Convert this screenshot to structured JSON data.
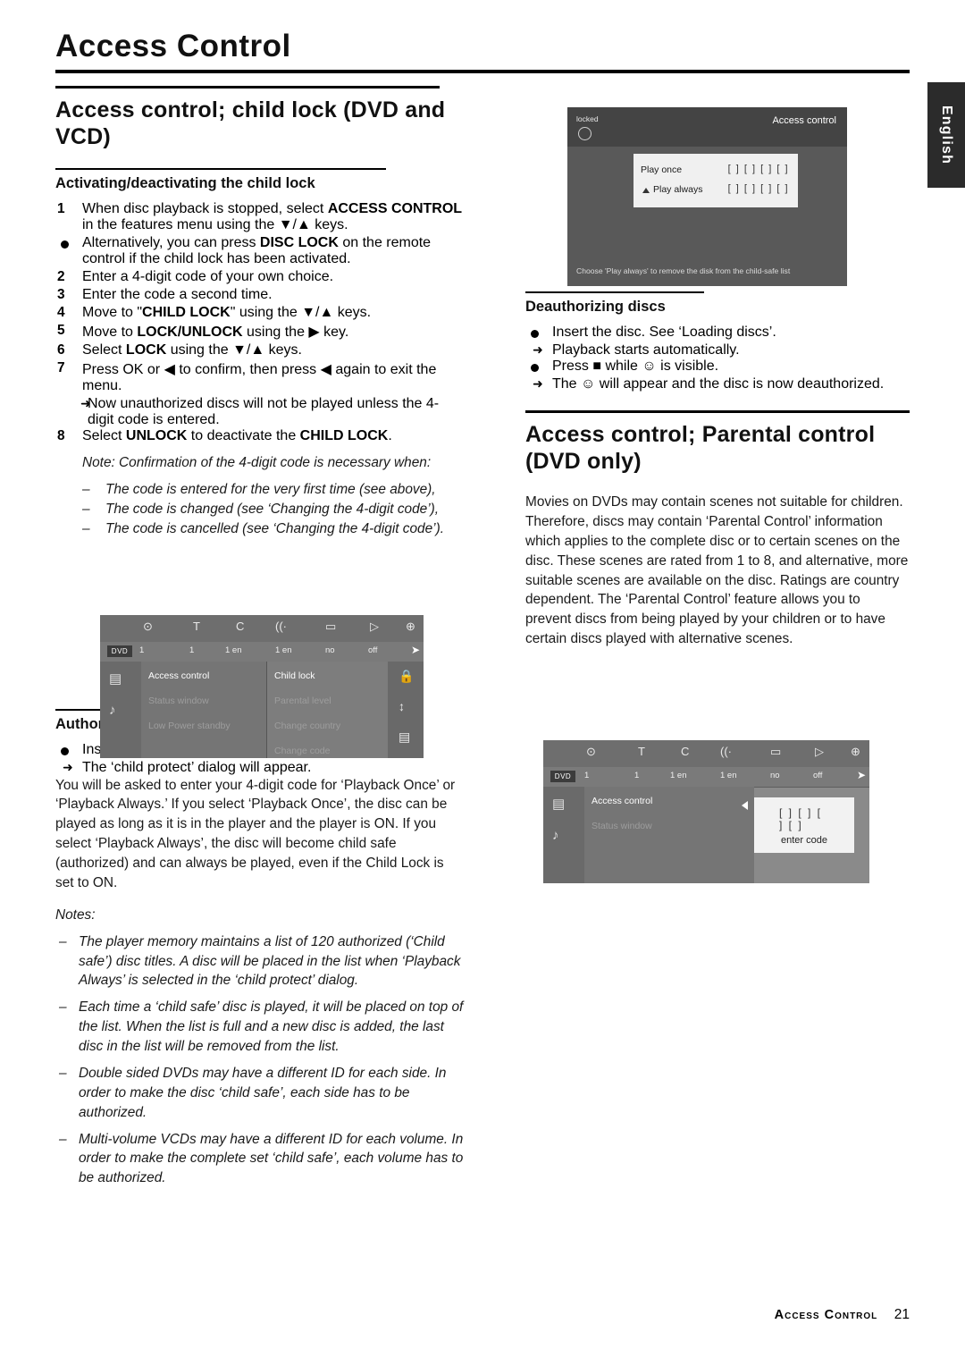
{
  "header": {
    "title": "Access Control",
    "language_tab": "English"
  },
  "left_column": {
    "section_title": "Access control; child lock (DVD and VCD)",
    "subsection_1": "Activating/deactivating the child lock",
    "steps": [
      {
        "num": "1",
        "parts": [
          "When disc playback is stopped, select ",
          "ACCESS CONTROL",
          " in the features menu using the ▼/▲ keys."
        ]
      },
      {
        "num": "2",
        "text": "Enter a 4-digit code of your own choice."
      },
      {
        "num": "3",
        "text": "Enter the code a second time."
      },
      {
        "num": "4",
        "parts": [
          "Move to \"",
          "CHILD LOCK",
          "\" using the ▼/▲ keys."
        ]
      },
      {
        "num": "5",
        "parts": [
          "Move to ",
          "LOCK/UNLOCK",
          " using the ▶ key."
        ]
      },
      {
        "num": "6",
        "parts": [
          "Select ",
          "LOCK",
          " using the ▼/▲ keys."
        ]
      },
      {
        "num": "7",
        "text": "Press OK or ◀ to confirm, then press ◀ again to exit the menu."
      },
      {
        "num": "8",
        "parts": [
          "Select ",
          "UNLOCK",
          " to deactivate the ",
          "CHILD LOCK",
          "."
        ]
      }
    ],
    "bullet_alternatively": [
      "Alternatively, you can press ",
      "DISC LOCK",
      " on the remote control if the child lock has been activated."
    ],
    "arrow_after_7": "Now unauthorized discs will not be played unless the 4-digit code is entered.",
    "note_intro": "Note: Confirmation of the 4-digit code is necessary when:",
    "notes_dashes": [
      "The code is entered for the very first time (see above),",
      "The code is changed (see ‘Changing the 4-digit code’),",
      "The code is cancelled (see ‘Changing the 4-digit code’)."
    ],
    "subsection_2": "Authorizing discs",
    "auth_bullet": "Insert the disc. See ‘Loading discs’.",
    "auth_arrow": "The ‘child protect’ dialog will appear.",
    "auth_body": "You will be asked to enter your 4-digit code for ‘Playback Once’ or ‘Playback Always.’ If you select ‘Playback Once’, the disc can be played as long as it is in the player and the player is ON. If you select ‘Playback Always’, the disc will become child safe (authorized) and can always be played, even if the Child Lock is set to ON.",
    "notes_label": "Notes:",
    "auth_notes": [
      "The player memory maintains a list of 120 authorized (‘Child safe’) disc titles. A disc will be placed in the list when ‘Playback Always’ is selected in the ‘child protect’ dialog.",
      "Each time a ‘child safe’ disc is played, it will be placed on top of the list. When the list is full and a new disc is added, the last disc in the list will be removed from the list.",
      "Double sided DVDs may have a different ID for each side. In order to make the disc ‘child safe’, each side has to be authorized.",
      "Multi-volume VCDs may have a different ID for each volume. In order to make the complete set ‘child safe’, each volume has to be authorized."
    ]
  },
  "right_column": {
    "subsection_deauth": "Deauthorizing discs",
    "deauth_bullet_1": "Insert the disc. See ‘Loading discs’.",
    "deauth_arrow_1": "Playback starts automatically.",
    "deauth_bullet_2": [
      "Press ",
      "■",
      " while ",
      "☺",
      " is visible."
    ],
    "deauth_arrow_2": [
      "The ",
      "☺",
      " will appear and the disc is now deauthorized."
    ],
    "section_title": "Access control; Parental control (DVD only)",
    "body": "Movies on DVDs may contain scenes not suitable for children. Therefore, discs may contain ‘Parental Control’ information which applies to the complete disc or to certain scenes on the disc. These scenes are rated from 1 to 8, and alternative, more suitable scenes are available on the disc. Ratings are country dependent. The ‘Parental Control’ feature allows you to prevent discs from being played by your children or to have certain discs played with alternative scenes."
  },
  "osd_child_protect": {
    "locked_label": "locked",
    "title": "Access control",
    "row_1": "Play once",
    "row_2": "Play always",
    "code_boxes": "[ ] [ ] [ ] [ ]",
    "footer_text": "Choose 'Play always' to remove the disk from the child-safe list"
  },
  "osd_menu_child_lock": {
    "value_bar": [
      "1",
      "1",
      "1 en",
      "1 en",
      "no",
      "off"
    ],
    "disc_chip": "DVD",
    "menu_items": [
      {
        "label": "Access control",
        "state": "on"
      },
      {
        "label": "Status window",
        "state": "off"
      },
      {
        "label": "Low Power standby",
        "state": "off"
      }
    ],
    "submenu_items": [
      {
        "label": "Child lock",
        "state": "on"
      },
      {
        "label": "Parental level",
        "state": "off"
      },
      {
        "label": "Change country",
        "state": "off"
      },
      {
        "label": "Change code",
        "state": "off"
      }
    ],
    "icons": [
      "disc-icon",
      "T",
      "C",
      "audio-icon",
      "subtitle-icon",
      "angle-icon",
      "zoom-icon"
    ],
    "side_icons": [
      "picture-icon",
      "sound-icon"
    ],
    "right_icons": [
      "lock-icon",
      "updown-icon",
      "list-icon"
    ]
  },
  "osd_menu_parental": {
    "value_bar": [
      "1",
      "1",
      "1 en",
      "1 en",
      "no",
      "off"
    ],
    "disc_chip": "DVD",
    "menu_items": [
      {
        "label": "Access control",
        "state": "on"
      },
      {
        "label": "Status window",
        "state": "off"
      }
    ],
    "code_boxes": "[ ] [ ] [ ] [ ]",
    "enter_code_label": "enter code",
    "icons": [
      "disc-icon",
      "T",
      "C",
      "audio-icon",
      "subtitle-icon",
      "angle-icon",
      "zoom-icon"
    ],
    "side_icons": [
      "picture-icon",
      "sound-icon"
    ]
  },
  "footer": {
    "name": "Access Control",
    "page_number": "21"
  }
}
